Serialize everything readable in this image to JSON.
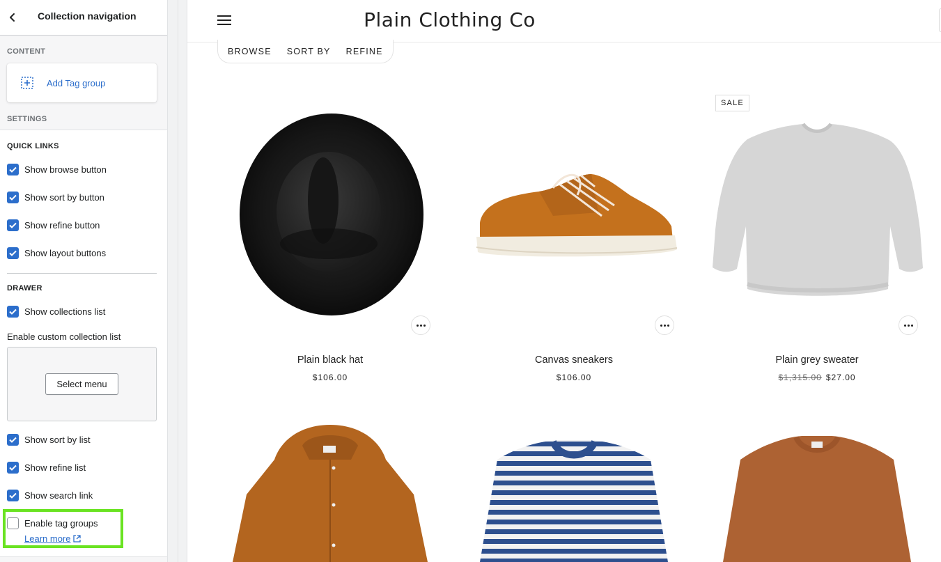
{
  "sidebar": {
    "title": "Collection navigation",
    "content_label": "CONTENT",
    "add_tag_group": "Add Tag group",
    "settings_label": "SETTINGS",
    "quick_links_label": "QUICK LINKS",
    "quick_links": [
      {
        "label": "Show browse button",
        "checked": true
      },
      {
        "label": "Show sort by button",
        "checked": true
      },
      {
        "label": "Show refine button",
        "checked": true
      },
      {
        "label": "Show layout buttons",
        "checked": true
      }
    ],
    "drawer_label": "DRAWER",
    "show_collections_list": "Show collections list",
    "custom_collection_label": "Enable custom collection list",
    "select_menu": "Select menu",
    "drawer_options": [
      {
        "label": "Show sort by list",
        "checked": true
      },
      {
        "label": "Show refine list",
        "checked": true
      },
      {
        "label": "Show search link",
        "checked": true
      }
    ],
    "enable_tag_groups": "Enable tag groups",
    "learn_more": "Learn more"
  },
  "store": {
    "title": "Plain Clothing Co",
    "nav": [
      "BROWSE",
      "SORT BY",
      "REFINE"
    ],
    "products": [
      {
        "name": "Plain black hat",
        "price": "$106.00"
      },
      {
        "name": "Canvas sneakers",
        "price": "$106.00"
      },
      {
        "name": "Plain grey sweater",
        "compare_price": "$1,315.00",
        "price": "$27.00",
        "badge": "SALE"
      }
    ]
  },
  "colors": {
    "accent": "#2c6ecb",
    "highlight": "#6ae322"
  }
}
